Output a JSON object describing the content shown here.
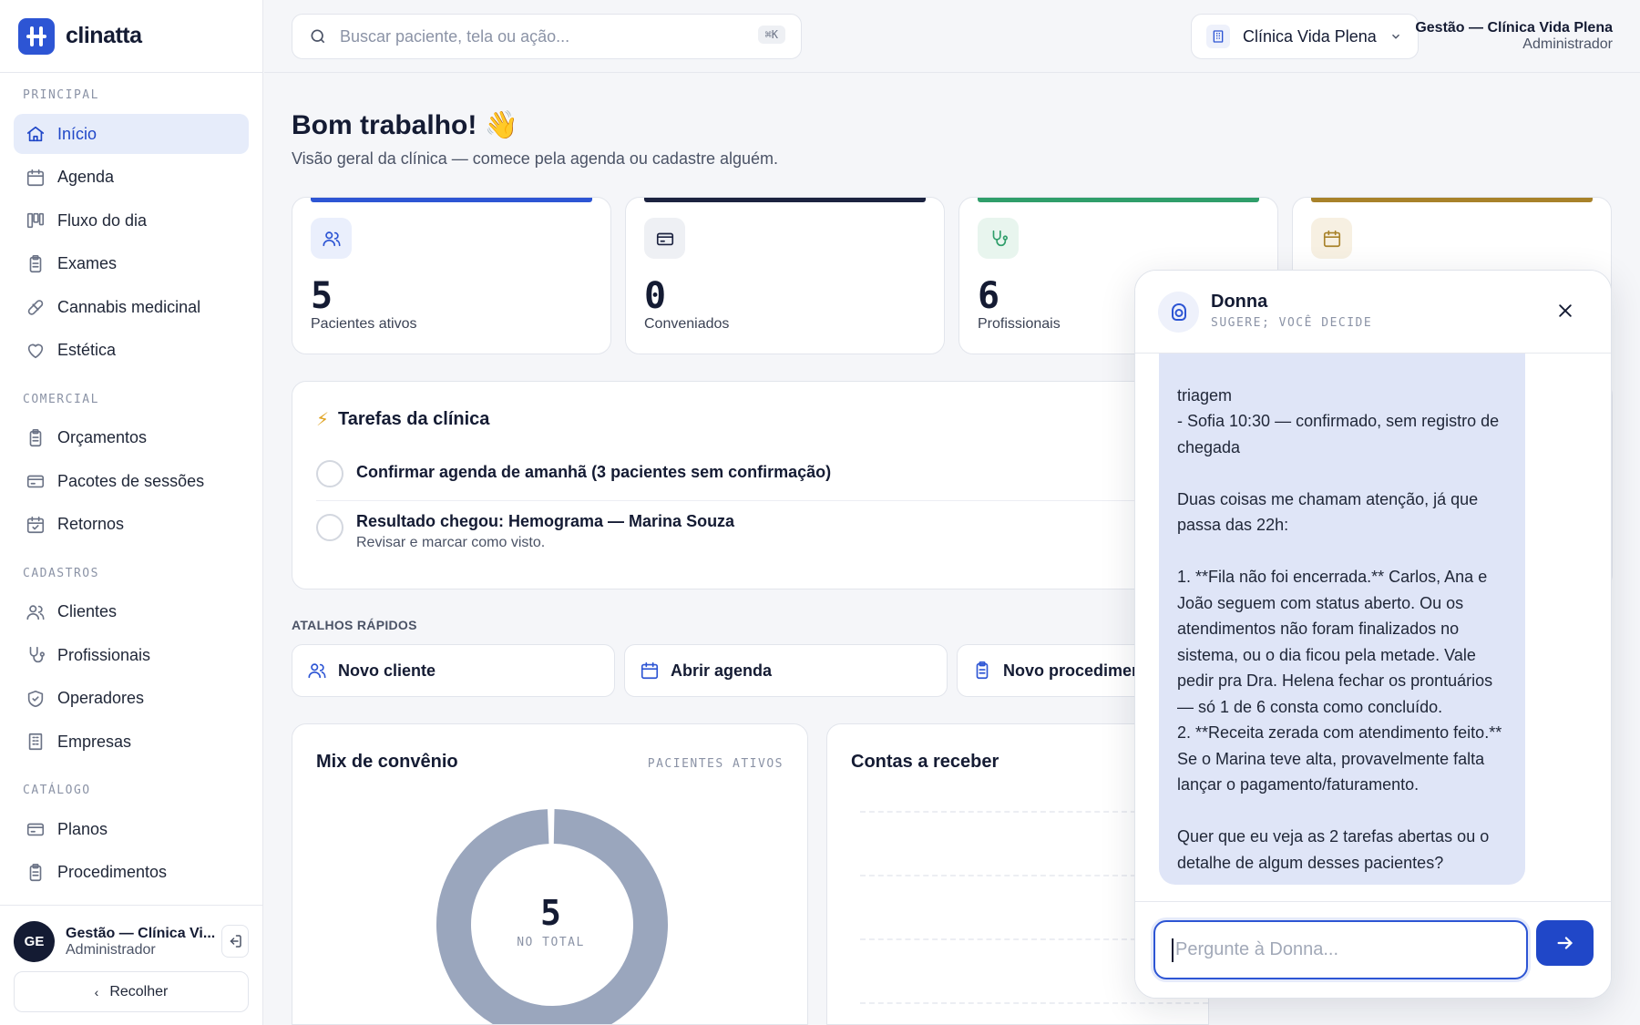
{
  "brand": {
    "name": "clinatta",
    "accent": "#2d55d4"
  },
  "search": {
    "placeholder": "Buscar paciente, tela ou ação...",
    "shortcut": "⌘K"
  },
  "clinic_selector": {
    "label": "Clínica Vida Plena"
  },
  "account": {
    "title": "Gestão — Clínica Vida Plena",
    "role": "Administrador"
  },
  "sidebar": {
    "sections": [
      {
        "title": "PRINCIPAL",
        "items": [
          {
            "label": "Início",
            "icon": "home-icon",
            "active": true
          },
          {
            "label": "Agenda",
            "icon": "calendar-icon"
          },
          {
            "label": "Fluxo do dia",
            "icon": "kanban-icon"
          },
          {
            "label": "Exames",
            "icon": "clipboard-icon"
          },
          {
            "label": "Cannabis medicinal",
            "icon": "pill-icon"
          },
          {
            "label": "Estética",
            "icon": "heart-icon"
          }
        ]
      },
      {
        "title": "COMERCIAL",
        "items": [
          {
            "label": "Orçamentos",
            "icon": "clipboard-icon"
          },
          {
            "label": "Pacotes de sessões",
            "icon": "card-icon"
          },
          {
            "label": "Retornos",
            "icon": "calendar-check-icon"
          }
        ]
      },
      {
        "title": "CADASTROS",
        "items": [
          {
            "label": "Clientes",
            "icon": "users-icon"
          },
          {
            "label": "Profissionais",
            "icon": "stethoscope-icon"
          },
          {
            "label": "Operadores",
            "icon": "shield-icon"
          },
          {
            "label": "Empresas",
            "icon": "building-icon"
          }
        ]
      },
      {
        "title": "CATÁLOGO",
        "items": [
          {
            "label": "Planos",
            "icon": "card-icon"
          },
          {
            "label": "Procedimentos",
            "icon": "clipboard-icon"
          },
          {
            "label": "Tabela de preços",
            "icon": "table-icon"
          }
        ]
      }
    ],
    "user": {
      "initials": "GE",
      "name": "Gestão — Clínica Vi...",
      "role": "Administrador"
    },
    "collapse_label": "Recolher"
  },
  "main": {
    "greeting": "Bom trabalho! 👋",
    "subtitle": "Visão geral da clínica — comece pela agenda ou cadastre alguém.",
    "stats": [
      {
        "value": "5",
        "label": "Pacientes ativos",
        "color": "#2d55d4",
        "icon": "users-icon"
      },
      {
        "value": "0",
        "label": "Conveniados",
        "color": "#1c2340",
        "icon": "card-icon"
      },
      {
        "value": "6",
        "label": "Profissionais",
        "color": "#2f9e6a",
        "icon": "stethoscope-icon"
      },
      {
        "value": "",
        "label": "",
        "color": "#a8822a",
        "icon": "calendar-icon"
      }
    ],
    "tasks": {
      "title": "Tarefas da clínica",
      "items": [
        {
          "title": "Confirmar agenda de amanhã (3 pacientes sem confirmação)",
          "desc": ""
        },
        {
          "title": "Resultado chegou: Hemograma — Marina Souza",
          "desc": "Revisar e marcar como visto."
        }
      ]
    },
    "shortcuts": {
      "title": "ATALHOS RÁPIDOS",
      "items": [
        {
          "label": "Novo cliente",
          "icon": "users-icon"
        },
        {
          "label": "Abrir agenda",
          "icon": "calendar-icon"
        },
        {
          "label": "Novo procedimento",
          "icon": "clipboard-icon"
        }
      ]
    },
    "mix_card": {
      "title": "Mix de convênio",
      "tag": "PACIENTES ATIVOS",
      "total": "5",
      "total_label": "NO TOTAL"
    },
    "receivables_card": {
      "title": "Contas a receber"
    }
  },
  "chart_data": {
    "type": "pie",
    "title": "Mix de convênio",
    "categories": [
      "Pacientes ativos"
    ],
    "values": [
      5
    ],
    "colors": [
      "#9aa6bd"
    ]
  },
  "chat": {
    "name": "Donna",
    "subtitle": "SUGERE; VOCÊ DECIDE",
    "message": "triagem\n- Sofia 10:30 — confirmado, sem registro de chegada\n\nDuas coisas me chamam atenção, já que passa das 22h:\n\n1. **Fila não foi encerrada.** Carlos, Ana e João seguem com status aberto. Ou os atendimentos não foram finalizados no sistema, ou o dia ficou pela metade. Vale pedir pra Dra. Helena fechar os prontuários — só 1 de 6 consta como concluído.\n2. **Receita zerada com atendimento feito.** Se o Marina teve alta, provavelmente falta lançar o pagamento/faturamento.\n\nQuer que eu veja as 2 tarefas abertas ou o detalhe de algum desses pacientes?",
    "input_placeholder": "Pergunte à Donna...",
    "send_icon": "arrow-right-icon"
  }
}
